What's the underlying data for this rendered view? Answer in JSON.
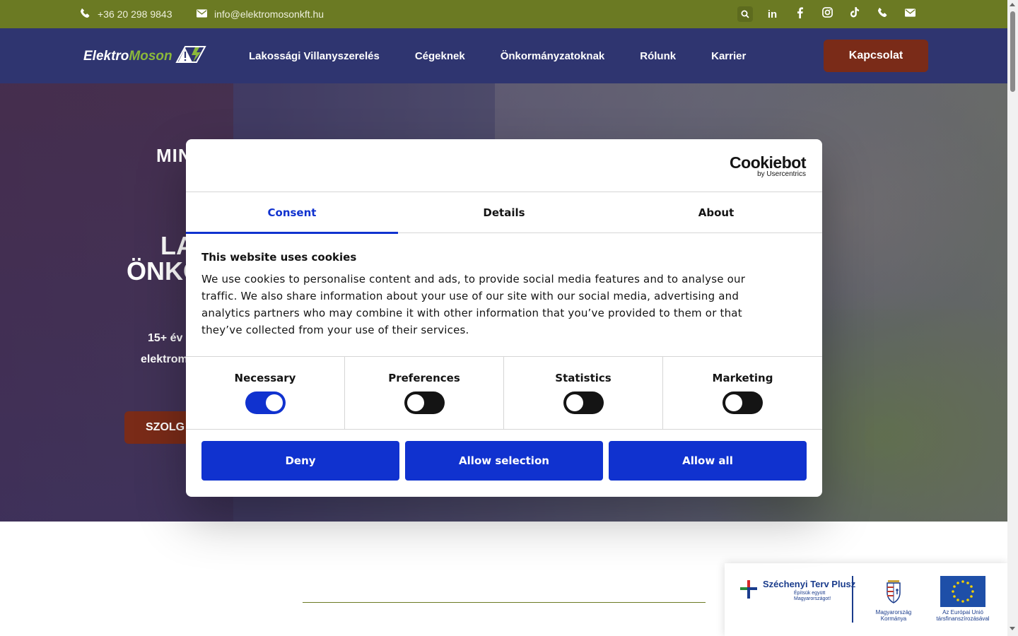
{
  "topbar": {
    "phone": "+36 20 298 9843",
    "email": "info@elektromosonkft.hu",
    "social_icons": [
      "search-icon",
      "linkedin-icon",
      "facebook-icon",
      "instagram-icon",
      "tiktok-icon",
      "phone-icon",
      "email-icon"
    ],
    "color": "#6b7a23"
  },
  "nav": {
    "logo_part1": "Elektro",
    "logo_part2": "Moson",
    "items": [
      {
        "label": "Lakossági Villanyszerelés"
      },
      {
        "label": "Cégeknek"
      },
      {
        "label": "Önkormányzatoknak"
      },
      {
        "label": "Rólunk"
      },
      {
        "label": "Karrier"
      }
    ],
    "cta_label": "Kapcsolat",
    "bg_color": "#2f3570",
    "cta_color": "#7a2b18"
  },
  "hero": {
    "subtitle_partial": "MIN",
    "heading_line1": "LA",
    "heading_line2": "ÖNKO",
    "text_line1": "15+ év t",
    "text_line2": "elektrom",
    "button_partial": "SZOLG"
  },
  "eu_badge": {
    "szechenyi_title": "Széchenyi Terv Plusz",
    "szechenyi_tagline": "Építsük együtt Magyarországot!",
    "gov_label": "Magyarország Kormánya",
    "eu_label": "Az Európai Unió társfinanszírozásával"
  },
  "cookie_dialog": {
    "brand": "Cookiebot",
    "brand_by": "by Usercentrics",
    "tabs": [
      {
        "label": "Consent",
        "active": true
      },
      {
        "label": "Details",
        "active": false
      },
      {
        "label": "About",
        "active": false
      }
    ],
    "heading": "This website uses cookies",
    "body": "We use cookies to personalise content and ads, to provide social media features and to analyse our traffic. We also share information about your use of our site with our social media, advertising and analytics partners who may combine it with other information that you’ve provided to them or that they’ve collected from your use of their services.",
    "categories": [
      {
        "label": "Necessary",
        "enabled": true
      },
      {
        "label": "Preferences",
        "enabled": false
      },
      {
        "label": "Statistics",
        "enabled": false
      },
      {
        "label": "Marketing",
        "enabled": false
      }
    ],
    "buttons": {
      "deny": "Deny",
      "allow_selection": "Allow selection",
      "allow_all": "Allow all"
    },
    "accent_color": "#1032cf"
  }
}
